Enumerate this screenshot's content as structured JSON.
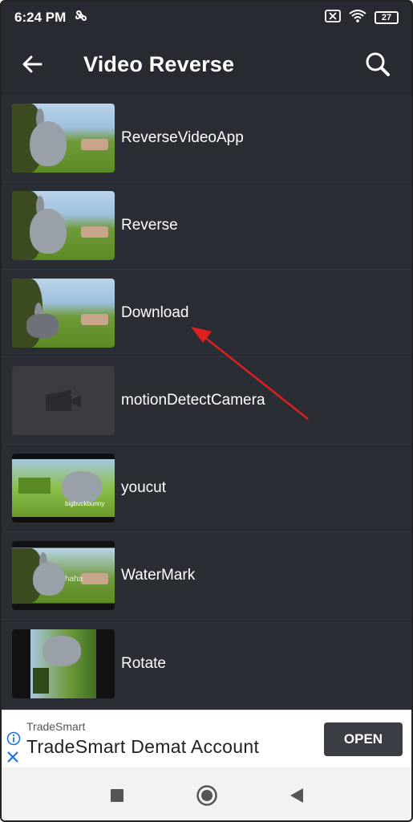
{
  "status_bar": {
    "time": "6:24 PM",
    "battery": "27"
  },
  "app_bar": {
    "title": "Video Reverse",
    "back_icon": "arrow-left-icon",
    "search_icon": "search-icon"
  },
  "folders": [
    {
      "label": "ReverseVideoApp",
      "thumbnail": "bunny"
    },
    {
      "label": "Reverse",
      "thumbnail": "bunny"
    },
    {
      "label": "Download",
      "thumbnail": "bunny"
    },
    {
      "label": "motionDetectCamera",
      "thumbnail": "video-placeholder"
    },
    {
      "label": "youcut",
      "thumbnail": "rotated-bunny"
    },
    {
      "label": "WaterMark",
      "thumbnail": "watermarked-bunny"
    },
    {
      "label": "Rotate",
      "thumbnail": "rotated-bunny"
    }
  ],
  "thumb_texts": {
    "youcut": "bigbuckbunny",
    "watermark": "haha"
  },
  "ad": {
    "brand": "TradeSmart",
    "title": "TradeSmart Demat Account",
    "button": "OPEN"
  },
  "nav_bar": {
    "icons": [
      "recents-square-icon",
      "home-circle-icon",
      "back-triangle-icon"
    ]
  },
  "colors": {
    "background": "#2a2d34",
    "app_bar": "#272a31",
    "annotation_arrow": "#e02020",
    "ad_button": "#3a3d44"
  }
}
